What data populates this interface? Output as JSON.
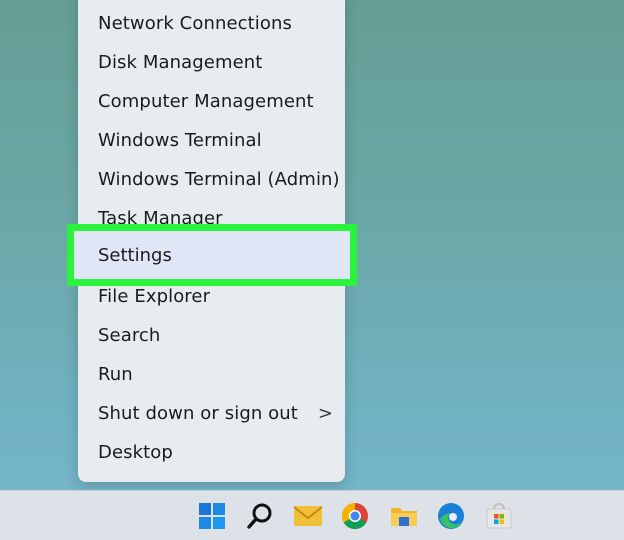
{
  "menu": {
    "items": [
      {
        "label": "Network Connections"
      },
      {
        "label": "Disk Management"
      },
      {
        "label": "Computer Management"
      },
      {
        "label": "Windows Terminal"
      },
      {
        "label": "Windows Terminal (Admin)"
      },
      {
        "label": "Task Manager"
      },
      {
        "label": "Settings",
        "highlighted": true
      },
      {
        "label": "File Explorer"
      },
      {
        "label": "Search"
      },
      {
        "label": "Run"
      },
      {
        "label": "Shut down or sign out",
        "submenu": ">"
      },
      {
        "label": "Desktop"
      }
    ]
  },
  "highlight": {
    "color": "#2bf23a"
  },
  "taskbar": {
    "icons": [
      "windows-start-icon",
      "search-icon",
      "mail-icon",
      "chrome-icon",
      "file-explorer-icon",
      "edge-icon",
      "store-icon"
    ]
  },
  "colors": {
    "background_top": "#669e96",
    "background_bottom": "#76b7ce",
    "menu_bg": "#e8ecf0",
    "taskbar_bg": "#dde2e8"
  }
}
